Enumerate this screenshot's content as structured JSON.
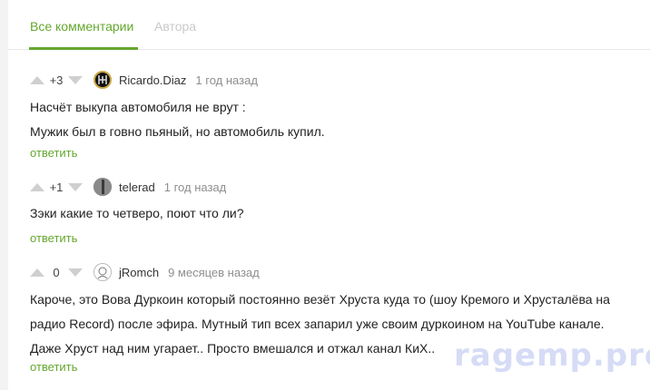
{
  "tabs": [
    {
      "label": "Все комментарии"
    },
    {
      "label": "Автора"
    }
  ],
  "comments": [
    {
      "score": "+3",
      "author": "Ricardo.Diaz",
      "time": "1 год назад",
      "lines": [
        "Насчёт выкупа автомобиля не врут :",
        "Мужик был в говно пьяный, но автомобиль купил."
      ],
      "reply": "ответить"
    },
    {
      "score": "+1",
      "author": "telerad",
      "time": "1 год назад",
      "lines": [
        "Зэки какие то четверо, поют что ли?"
      ],
      "reply": "ответить"
    },
    {
      "score": "0",
      "author": "jRomch",
      "time": "9 месяцев назад",
      "lines": [
        "Кароче, это Вова Дуркоин который постоянно везёт Хруста куда то (шоу Кремого и Хрусталёва на",
        "радио Record) после эфира. Мутный тип всех запарил уже своим дуркоином на YouTube канале.",
        "Даже Хруст над ним угарает.. Просто вмешался и отжал канал КиХ.."
      ],
      "reply": "ответить"
    }
  ],
  "watermark": "ragemp.pro",
  "colors": {
    "accent": "#64a72e",
    "muted": "#8e8e8e",
    "arrow": "#cfcfcf"
  }
}
